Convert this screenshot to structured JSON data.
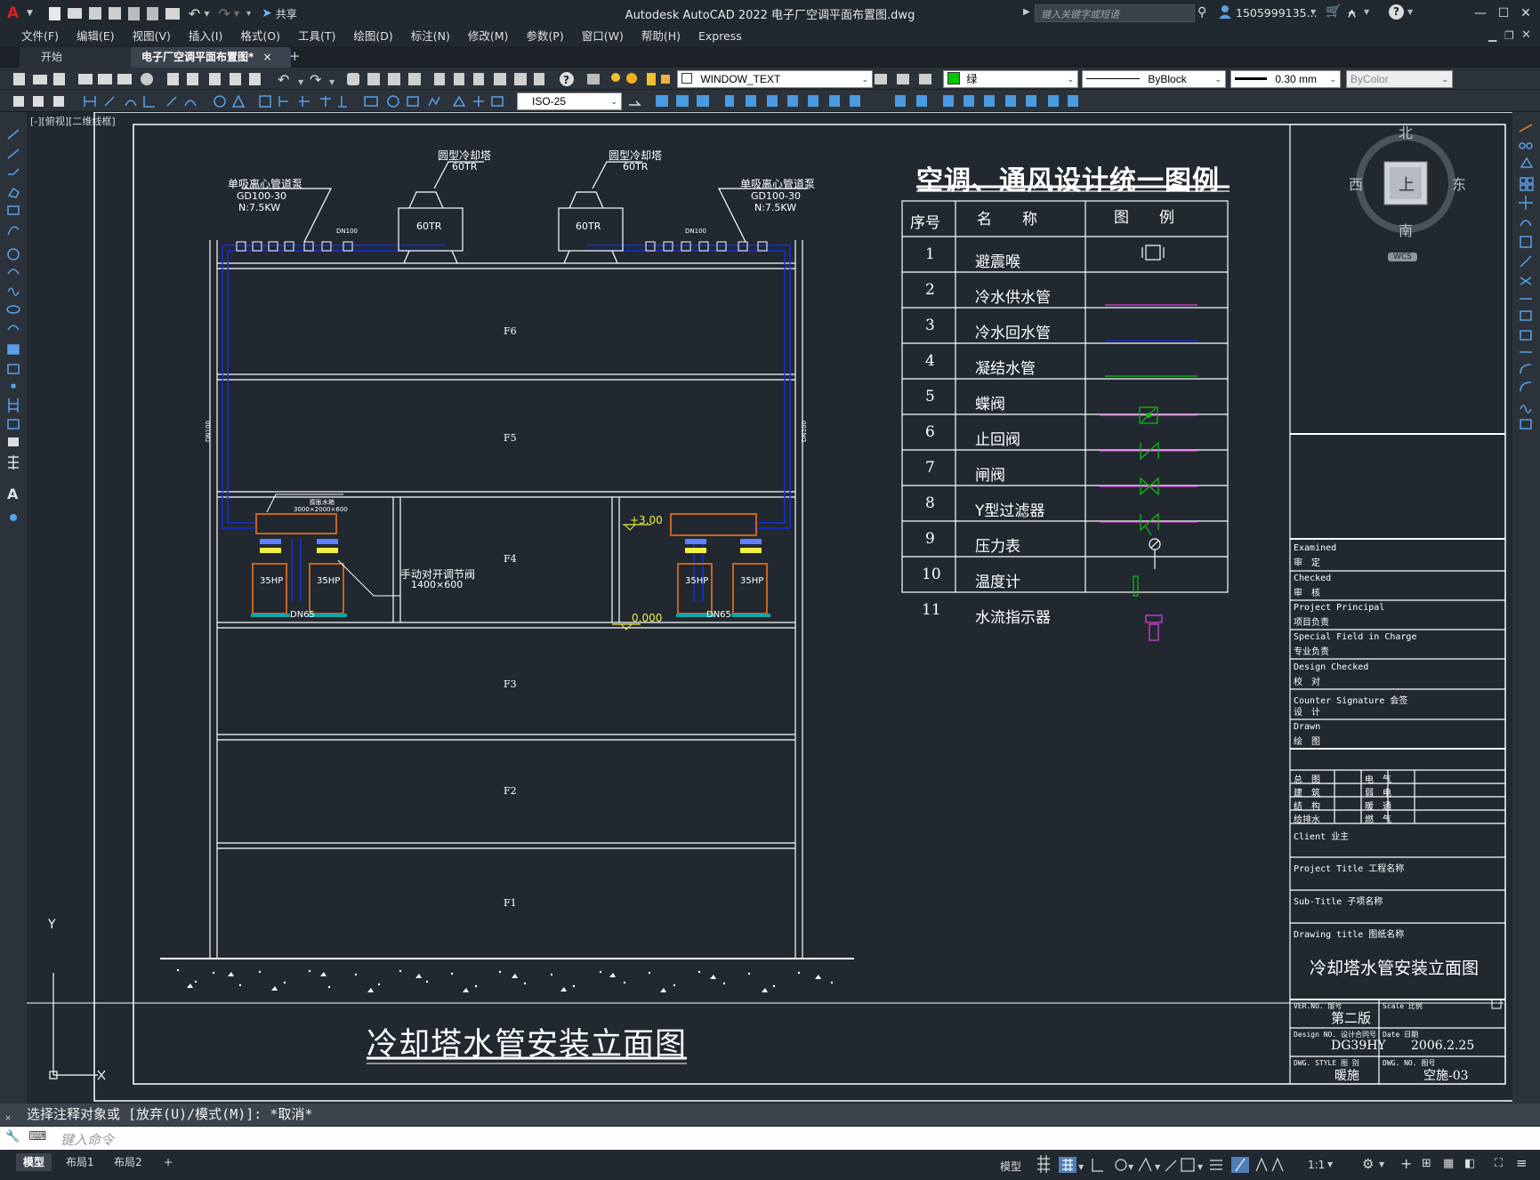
{
  "titlebar": {
    "app_title": "Autodesk AutoCAD 2022    电子厂空调平面布置图.dwg",
    "share_label": "共享",
    "search_placeholder": "键入关键字或短语",
    "user": "1505999135..."
  },
  "menu": [
    "文件(F)",
    "编辑(E)",
    "视图(V)",
    "插入(I)",
    "格式(O)",
    "工具(T)",
    "绘图(D)",
    "标注(N)",
    "修改(M)",
    "参数(P)",
    "窗口(W)",
    "帮助(H)",
    "Express"
  ],
  "tabs": {
    "start": "开始",
    "active": "电子厂空调平面布置图*",
    "close": "×",
    "add": "+"
  },
  "toolbar": {
    "layer_name": "WINDOW_TEXT",
    "color_name": "绿",
    "linetype": "ByBlock",
    "lineweight": "0.30 mm",
    "plotstyle": "ByColor",
    "dimstyle": "ISO-25"
  },
  "viewport_label": "[-][俯视][二维线框]",
  "viewcube": {
    "north": "北",
    "south": "南",
    "east": "东",
    "west": "西",
    "top": "上",
    "wcs": "WCS"
  },
  "drawing": {
    "legend_title": "空调、通风设计统一图例",
    "legend_headers": [
      "序号",
      "名　　称",
      "图　　例"
    ],
    "legend_rows": [
      {
        "no": "1",
        "name": "避震喉",
        "sym": "flex"
      },
      {
        "no": "2",
        "name": "冷水供水管",
        "sym": "line-magenta"
      },
      {
        "no": "3",
        "name": "冷水回水管",
        "sym": "line-blue"
      },
      {
        "no": "4",
        "name": "凝结水管",
        "sym": "line-green"
      },
      {
        "no": "5",
        "name": "蝶阀",
        "sym": "butterfly"
      },
      {
        "no": "6",
        "name": "止回阀",
        "sym": "check"
      },
      {
        "no": "7",
        "name": "闸阀",
        "sym": "gate"
      },
      {
        "no": "8",
        "name": "Y型过滤器",
        "sym": "yfilter"
      },
      {
        "no": "9",
        "name": "压力表",
        "sym": "gauge"
      },
      {
        "no": "10",
        "name": "温度计",
        "sym": "thermo"
      },
      {
        "no": "11",
        "name": "水流指示器",
        "sym": "flow"
      }
    ],
    "floors": [
      "F6",
      "F5",
      "F4",
      "F3",
      "F2",
      "F1"
    ],
    "tower_label": "圆型冷却塔",
    "tower_capacity": "60TR",
    "tower_box": "60TR",
    "pump_label": "单吸离心管道泵",
    "pump_model": "GD100-30",
    "pump_power": "N:7.5KW",
    "pipe_dn100": "DN100",
    "pipe_dn65": "DN65",
    "unit_hp": "35HP",
    "damper_label": "手动对开调节阀",
    "damper_size": "1400×600",
    "tank_label": "膨胀水箱",
    "tank_size": "3000×2000×600",
    "level_300": "+3.00",
    "level_000": "0.000",
    "sheet_title": "冷却塔水管安装立面图",
    "axis_y": "Y"
  },
  "titleblock": {
    "examined": "Examined",
    "examined_cn": "审　定",
    "checked": "Checked",
    "checked_cn": "审　核",
    "principal": "Project Principal",
    "principal_cn": "项目负责",
    "special": "Special Field in Charge",
    "special_cn": "专业负责",
    "design_checked": "Design Checked",
    "design_checked_cn": "校　对",
    "counter": "Counter Signature  会签",
    "counter_cn": "设　计",
    "drawn": "Drawn",
    "drawn_cn": "绘　图",
    "disc_left": [
      "总　图",
      "建　筑",
      "结　构",
      "给排水"
    ],
    "disc_right": [
      "电　气",
      "弱　电",
      "暖　通",
      "燃　气"
    ],
    "client": "Client  业主",
    "project_title": "Project Title  工程名称",
    "subtitle": "Sub-Title  子项名称",
    "drawing_title": "Drawing title  图纸名称",
    "drawing_title_value": "冷却塔水管安装立面图",
    "ver_label": "VER.NO. 版号",
    "ver_value": "第二版",
    "scale_label": "Scale 比例",
    "design_no_label": "Design NO. 设计合同号",
    "design_no_value": "DG39HY",
    "date_label": "Date 日期",
    "date_value": "2006.2.25",
    "style_label": "DWG. STYLE 图 别",
    "style_value": "暖施",
    "dwg_no_label": "DWG. NO. 图号",
    "dwg_no_value": "空施-03"
  },
  "command": {
    "history": "选择注释对象或 [放弃(U)/模式(M)]: *取消*",
    "placeholder": "键入命令"
  },
  "layout_tabs": [
    "模型",
    "布局1",
    "布局2",
    "+"
  ],
  "status": {
    "model": "模型",
    "scale": "1:1"
  }
}
